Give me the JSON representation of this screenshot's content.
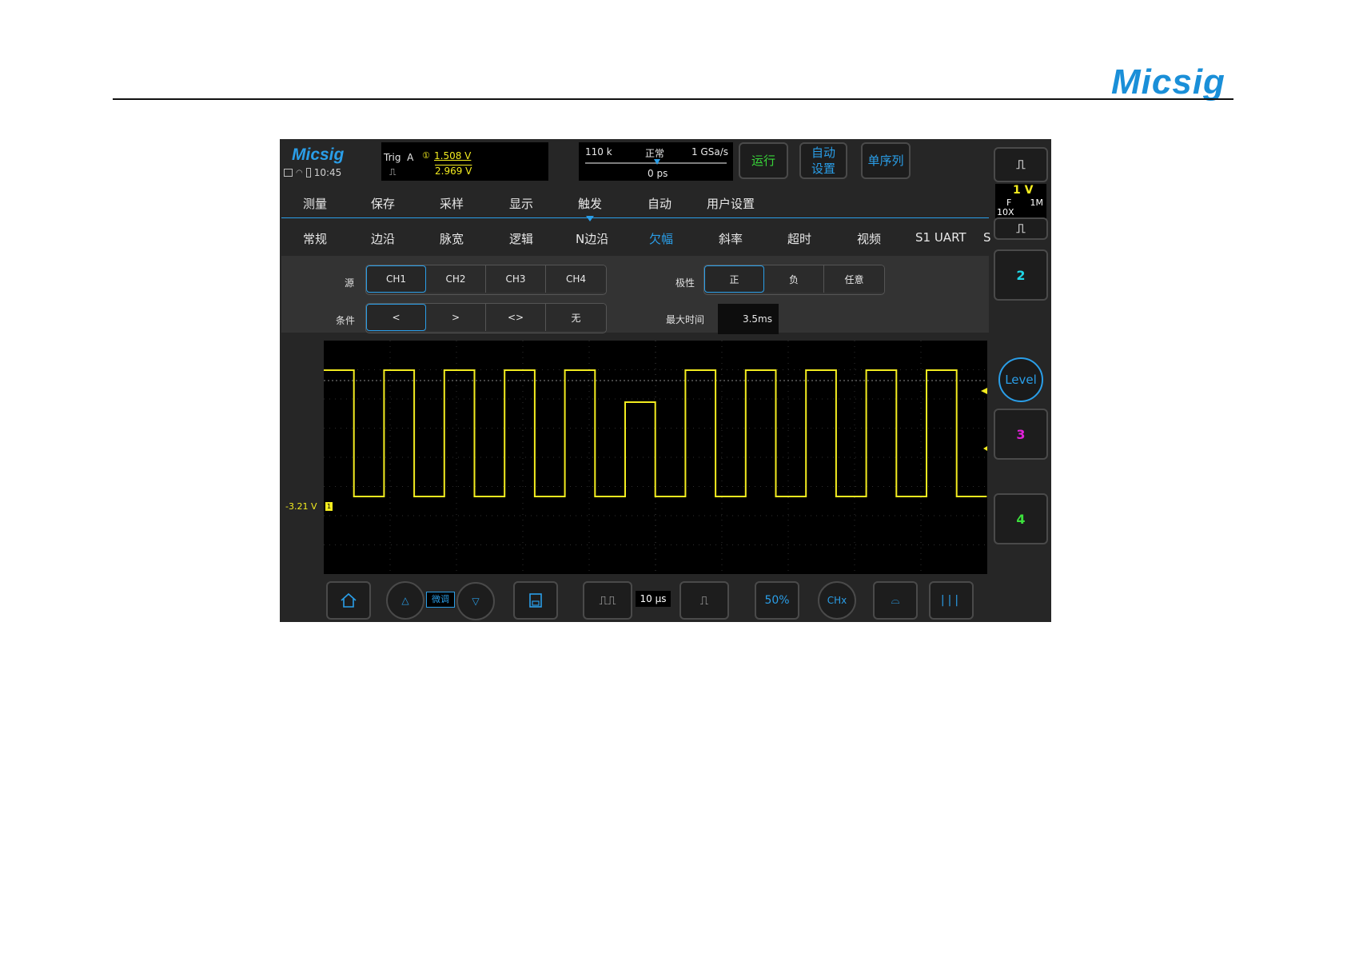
{
  "document": {
    "logo": "Micsig"
  },
  "header": {
    "brand": "Micsig",
    "time": "10:45"
  },
  "trigger_info": {
    "label": "Trig",
    "source": "A",
    "level1": "1.508  V",
    "level2": "2.969  V"
  },
  "timebase_info": {
    "memory_depth": "110 k",
    "mode": "正常",
    "sample_rate": "1 GSa/s",
    "position": "0 ps"
  },
  "top_buttons": {
    "run": "运行",
    "auto_setup_line1": "自动",
    "auto_setup_line2": "设置",
    "single": "单序列"
  },
  "menu": [
    "测量",
    "保存",
    "采样",
    "显示",
    "触发",
    "自动",
    "用户设置"
  ],
  "active_menu": "触发",
  "submenu": [
    "常规",
    "边沿",
    "脉宽",
    "逻辑",
    "N边沿",
    "欠幅",
    "斜率",
    "超时",
    "视频",
    "S1 UART",
    "S"
  ],
  "active_submenu": "欠幅",
  "params": {
    "source_label": "源",
    "source_options": [
      "CH1",
      "CH2",
      "CH3",
      "CH4"
    ],
    "source_selected": "CH1",
    "polarity_label": "极性",
    "polarity_options": [
      "正",
      "负",
      "任意"
    ],
    "polarity_selected": "正",
    "condition_label": "条件",
    "condition_options": [
      "<",
      ">",
      "<>",
      "无"
    ],
    "condition_selected": "<",
    "max_time_label": "最大时间",
    "max_time_value": "3.5ms"
  },
  "waveform": {
    "offset_label": "-3.21 V",
    "channel_marker": "1",
    "trace_color": "#f3ec1f"
  },
  "bottom_bar": {
    "fine_adjust": "微调",
    "timebase": "10 μs",
    "fifty_percent": "50%",
    "ch_button": "CHx"
  },
  "right_panel": {
    "ch1": {
      "volts_div": "1 V",
      "coupling": "F",
      "impedance": "1M",
      "probe": "10X"
    },
    "level_knob": "Level",
    "ch2": "2",
    "ch3": "3",
    "ch4": "4",
    "colors": {
      "ch2": "#1fd6e6",
      "ch3": "#e020d8",
      "ch4": "#3ce03c"
    }
  },
  "colors": {
    "accent": "#2a9ee8",
    "run": "#39d739",
    "ch1": "#f3ec1f"
  }
}
